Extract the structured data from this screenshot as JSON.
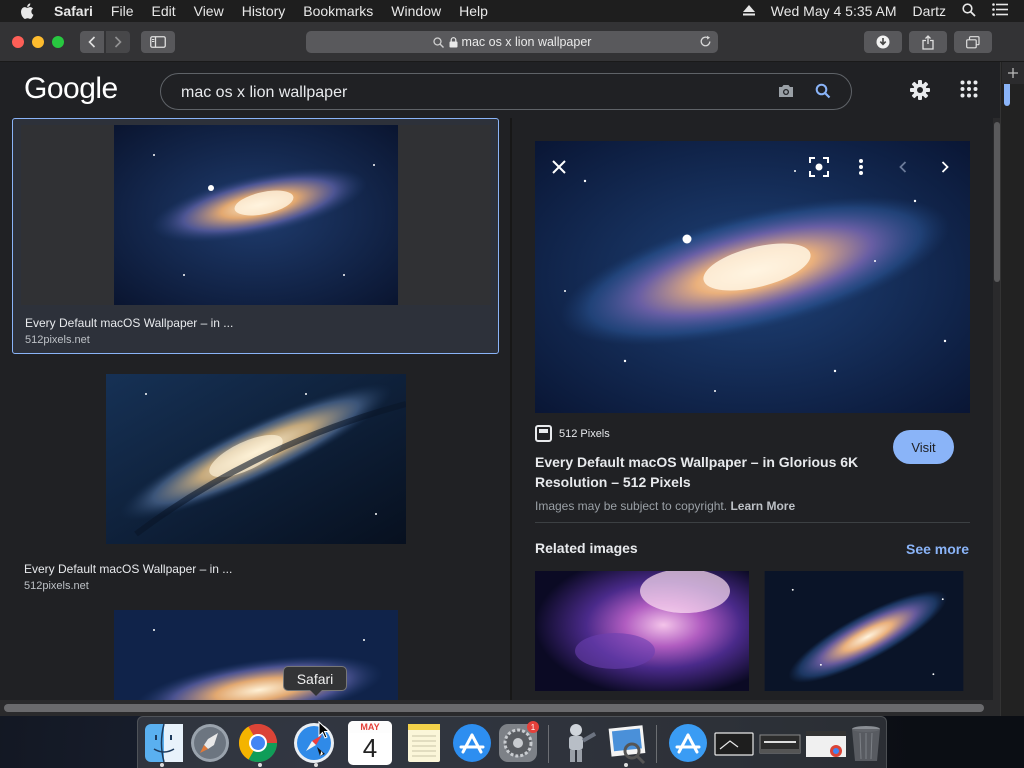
{
  "menubar": {
    "app": "Safari",
    "items": [
      "File",
      "Edit",
      "View",
      "History",
      "Bookmarks",
      "Window",
      "Help"
    ],
    "datetime": "Wed May 4  5:35 AM",
    "user": "Dartz"
  },
  "toolbar": {
    "url": "mac os x lion wallpaper"
  },
  "google": {
    "logo": "Google",
    "query": "mac os x lion wallpaper"
  },
  "results": [
    {
      "title": "Every Default macOS Wallpaper – in ...",
      "source": "512pixels.net"
    },
    {
      "title": "Every Default macOS Wallpaper – in ...",
      "source": "512pixels.net"
    }
  ],
  "panel": {
    "site": "512 Pixels",
    "title": "Every Default macOS Wallpaper – in Glorious 6K Resolution – 512 Pixels",
    "visit": "Visit",
    "copyright_text": "Images may be subject to copyright.",
    "learn_more": "Learn More",
    "related_heading": "Related images",
    "see_more": "See more"
  },
  "dock": {
    "tooltip": "Safari",
    "calendar_month": "MAY",
    "calendar_day": "4",
    "badge": "1"
  },
  "colors": {
    "accent": "#8ab4f8",
    "page_bg": "#202124",
    "selection_border": "#8ab4f8"
  }
}
